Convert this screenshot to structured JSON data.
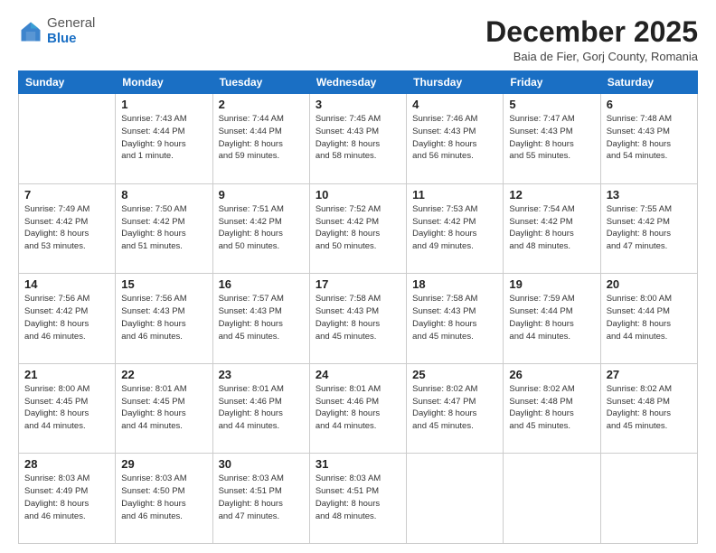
{
  "header": {
    "logo_general": "General",
    "logo_blue": "Blue",
    "month_title": "December 2025",
    "location": "Baia de Fier, Gorj County, Romania"
  },
  "weekdays": [
    "Sunday",
    "Monday",
    "Tuesday",
    "Wednesday",
    "Thursday",
    "Friday",
    "Saturday"
  ],
  "weeks": [
    [
      {
        "day": "",
        "info": ""
      },
      {
        "day": "1",
        "info": "Sunrise: 7:43 AM\nSunset: 4:44 PM\nDaylight: 9 hours\nand 1 minute."
      },
      {
        "day": "2",
        "info": "Sunrise: 7:44 AM\nSunset: 4:44 PM\nDaylight: 8 hours\nand 59 minutes."
      },
      {
        "day": "3",
        "info": "Sunrise: 7:45 AM\nSunset: 4:43 PM\nDaylight: 8 hours\nand 58 minutes."
      },
      {
        "day": "4",
        "info": "Sunrise: 7:46 AM\nSunset: 4:43 PM\nDaylight: 8 hours\nand 56 minutes."
      },
      {
        "day": "5",
        "info": "Sunrise: 7:47 AM\nSunset: 4:43 PM\nDaylight: 8 hours\nand 55 minutes."
      },
      {
        "day": "6",
        "info": "Sunrise: 7:48 AM\nSunset: 4:43 PM\nDaylight: 8 hours\nand 54 minutes."
      }
    ],
    [
      {
        "day": "7",
        "info": "Sunrise: 7:49 AM\nSunset: 4:42 PM\nDaylight: 8 hours\nand 53 minutes."
      },
      {
        "day": "8",
        "info": "Sunrise: 7:50 AM\nSunset: 4:42 PM\nDaylight: 8 hours\nand 51 minutes."
      },
      {
        "day": "9",
        "info": "Sunrise: 7:51 AM\nSunset: 4:42 PM\nDaylight: 8 hours\nand 50 minutes."
      },
      {
        "day": "10",
        "info": "Sunrise: 7:52 AM\nSunset: 4:42 PM\nDaylight: 8 hours\nand 50 minutes."
      },
      {
        "day": "11",
        "info": "Sunrise: 7:53 AM\nSunset: 4:42 PM\nDaylight: 8 hours\nand 49 minutes."
      },
      {
        "day": "12",
        "info": "Sunrise: 7:54 AM\nSunset: 4:42 PM\nDaylight: 8 hours\nand 48 minutes."
      },
      {
        "day": "13",
        "info": "Sunrise: 7:55 AM\nSunset: 4:42 PM\nDaylight: 8 hours\nand 47 minutes."
      }
    ],
    [
      {
        "day": "14",
        "info": "Sunrise: 7:56 AM\nSunset: 4:42 PM\nDaylight: 8 hours\nand 46 minutes."
      },
      {
        "day": "15",
        "info": "Sunrise: 7:56 AM\nSunset: 4:43 PM\nDaylight: 8 hours\nand 46 minutes."
      },
      {
        "day": "16",
        "info": "Sunrise: 7:57 AM\nSunset: 4:43 PM\nDaylight: 8 hours\nand 45 minutes."
      },
      {
        "day": "17",
        "info": "Sunrise: 7:58 AM\nSunset: 4:43 PM\nDaylight: 8 hours\nand 45 minutes."
      },
      {
        "day": "18",
        "info": "Sunrise: 7:58 AM\nSunset: 4:43 PM\nDaylight: 8 hours\nand 45 minutes."
      },
      {
        "day": "19",
        "info": "Sunrise: 7:59 AM\nSunset: 4:44 PM\nDaylight: 8 hours\nand 44 minutes."
      },
      {
        "day": "20",
        "info": "Sunrise: 8:00 AM\nSunset: 4:44 PM\nDaylight: 8 hours\nand 44 minutes."
      }
    ],
    [
      {
        "day": "21",
        "info": "Sunrise: 8:00 AM\nSunset: 4:45 PM\nDaylight: 8 hours\nand 44 minutes."
      },
      {
        "day": "22",
        "info": "Sunrise: 8:01 AM\nSunset: 4:45 PM\nDaylight: 8 hours\nand 44 minutes."
      },
      {
        "day": "23",
        "info": "Sunrise: 8:01 AM\nSunset: 4:46 PM\nDaylight: 8 hours\nand 44 minutes."
      },
      {
        "day": "24",
        "info": "Sunrise: 8:01 AM\nSunset: 4:46 PM\nDaylight: 8 hours\nand 44 minutes."
      },
      {
        "day": "25",
        "info": "Sunrise: 8:02 AM\nSunset: 4:47 PM\nDaylight: 8 hours\nand 45 minutes."
      },
      {
        "day": "26",
        "info": "Sunrise: 8:02 AM\nSunset: 4:48 PM\nDaylight: 8 hours\nand 45 minutes."
      },
      {
        "day": "27",
        "info": "Sunrise: 8:02 AM\nSunset: 4:48 PM\nDaylight: 8 hours\nand 45 minutes."
      }
    ],
    [
      {
        "day": "28",
        "info": "Sunrise: 8:03 AM\nSunset: 4:49 PM\nDaylight: 8 hours\nand 46 minutes."
      },
      {
        "day": "29",
        "info": "Sunrise: 8:03 AM\nSunset: 4:50 PM\nDaylight: 8 hours\nand 46 minutes."
      },
      {
        "day": "30",
        "info": "Sunrise: 8:03 AM\nSunset: 4:51 PM\nDaylight: 8 hours\nand 47 minutes."
      },
      {
        "day": "31",
        "info": "Sunrise: 8:03 AM\nSunset: 4:51 PM\nDaylight: 8 hours\nand 48 minutes."
      },
      {
        "day": "",
        "info": ""
      },
      {
        "day": "",
        "info": ""
      },
      {
        "day": "",
        "info": ""
      }
    ]
  ]
}
